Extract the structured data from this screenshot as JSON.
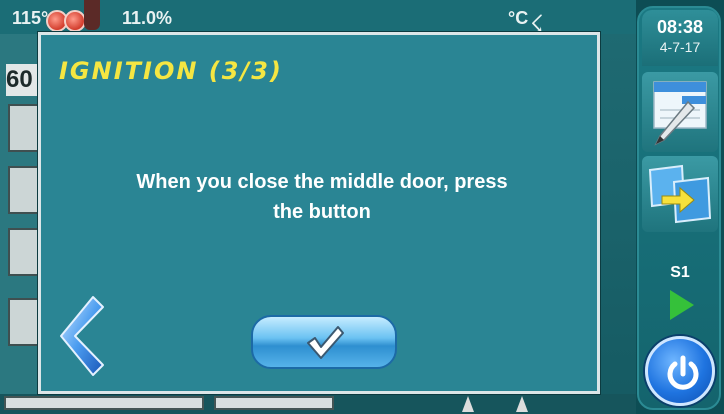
{
  "background": {
    "status_left": "115°C",
    "status_percent": "11.0%",
    "status_right": "°C",
    "big_value": "60"
  },
  "sidebar": {
    "time": "08:38",
    "date": "4-7-17",
    "edit_icon": "notes-edit-icon",
    "switch_icon": "window-switch-icon",
    "schedule_label": "S1",
    "play_icon": "play-icon",
    "power_icon": "power-icon"
  },
  "dialog": {
    "title": "IGNITION (3/3)",
    "message_line1": "When you close the middle door, press",
    "message_line2": "the button",
    "back_icon": "chevron-left-icon",
    "ok_icon": "checkmark-icon"
  },
  "colors": {
    "dialog_bg": "#2a8594",
    "title": "#f5e642",
    "play": "#35c13a",
    "power": "#1f74e0"
  }
}
